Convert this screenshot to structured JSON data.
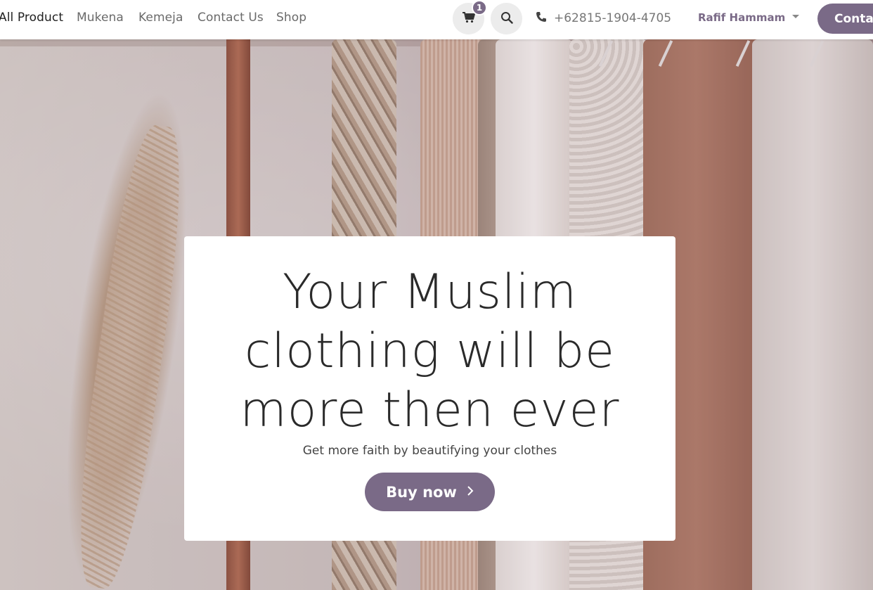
{
  "nav": {
    "links": [
      {
        "label": "All Product",
        "active": true
      },
      {
        "label": "Mukena",
        "active": false
      },
      {
        "label": "Kemeja",
        "active": false
      },
      {
        "label": "Contact Us",
        "active": false
      },
      {
        "label": "Shop",
        "active": false
      }
    ],
    "cart": {
      "icon": "cart-icon",
      "count": "1"
    },
    "search_icon": "search-icon",
    "phone": {
      "icon": "phone-icon",
      "number": "+62815-1904-4705"
    },
    "user": {
      "name": "Rafif Hammam",
      "icon": "chevron-down-icon"
    },
    "cta_label": "Contact Us"
  },
  "hero": {
    "headline_lines": [
      "Your Muslim",
      "clothing will be",
      "more then ever"
    ],
    "subline": "Get more faith by beautifying your clothes",
    "button_label": "Buy now",
    "button_icon": "chevron-right-icon"
  },
  "colors": {
    "accent": "#7a6a87",
    "text_dark": "#2a2a2a",
    "text_muted": "#6a6a6a"
  }
}
